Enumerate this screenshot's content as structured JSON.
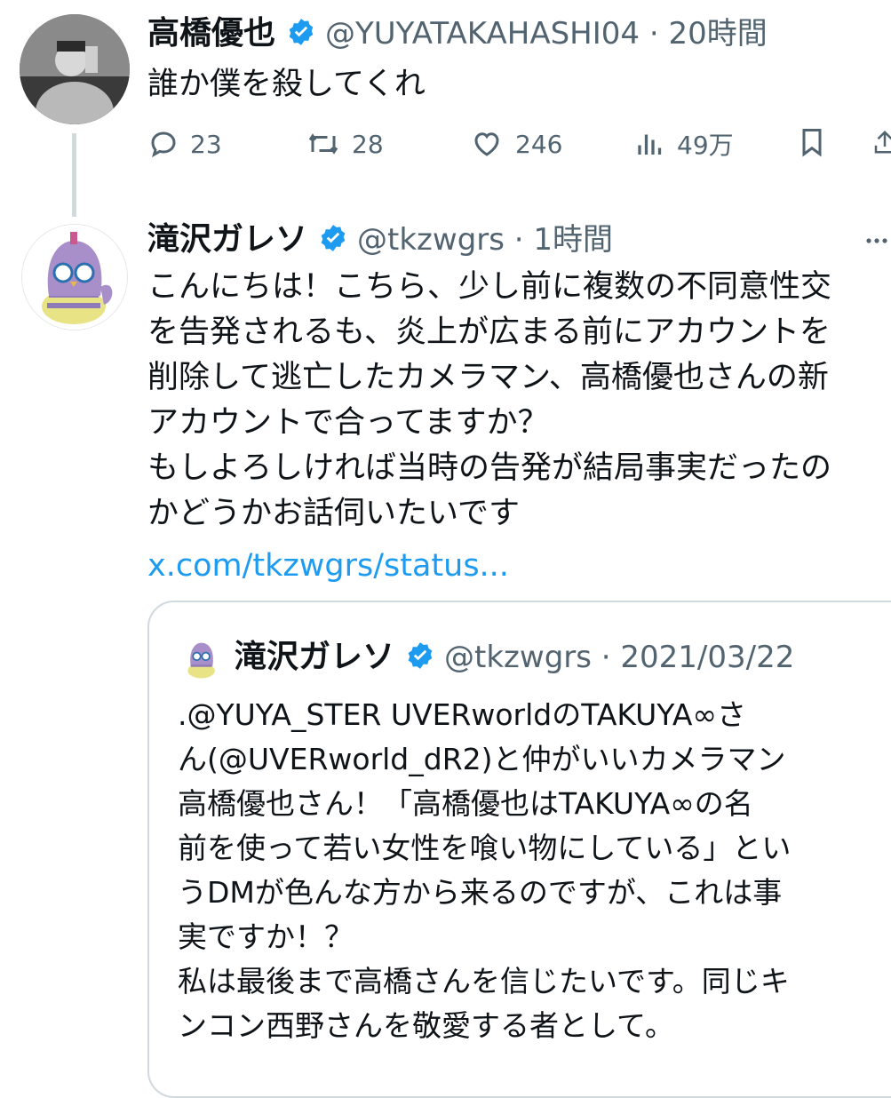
{
  "tweet1": {
    "display_name": "高橋優也",
    "handle_time": "@YUYATAKAHASHI04 · 20時間",
    "text": "誰か僕を殺してくれ",
    "actions": {
      "replies": "23",
      "retweets": "28",
      "likes": "246",
      "views": "49万"
    }
  },
  "reply": {
    "display_name": "滝沢ガレソ",
    "handle_time": "@tkzwgrs · 1時間",
    "lines": [
      "こんにちは！こちら、少し前に複数の不同意性交",
      "を告発されるも、炎上が広まる前にアカウントを",
      "削除して逃亡したカメラマン、高橋優也さんの新",
      "アカウントで合ってますか？",
      "もしよろしければ当時の告発が結局事実だったの",
      "かどうかお話伺いたいです"
    ],
    "link": "x.com/tkzwgrs/status..."
  },
  "quote": {
    "display_name": "滝沢ガレソ",
    "handle_time": "@tkzwgrs · 2021/03/22",
    "lines": [
      ".@YUYA_STER UVERworldのTAKUYA∞さ",
      "ん(@UVERworld_dR2)と仲がいいカメラマン",
      "高橋優也さん！「高橋優也はTAKUYA∞の名",
      "前を使って若い女性を喰い物にしている」とい",
      "うDMが色んな方から来るのですが、これは事",
      "実ですか！？",
      "私は最後まで高橋さんを信じたいです。同じキ",
      "ンコン西野さんを敬愛する者として。"
    ]
  },
  "colors": {
    "accent": "#1d9bf0",
    "secondary_text": "#536471",
    "border": "#cfd9de"
  }
}
